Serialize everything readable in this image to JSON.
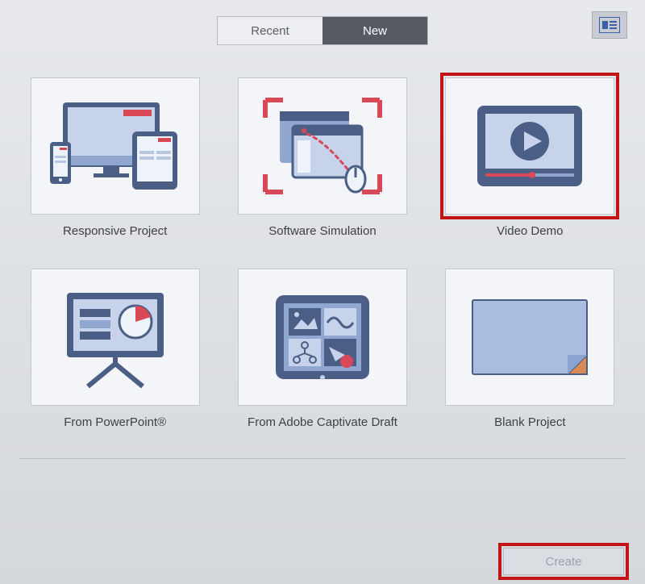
{
  "colors": {
    "accent_red": "#c11515",
    "slate_dark": "#4b5f86",
    "slate_mid": "#90a7cf",
    "slate_light": "#c6d3ea",
    "panel": "#f3f5f8"
  },
  "tabs": {
    "recent": "Recent",
    "new": "New",
    "active": "new"
  },
  "view_toggle": {
    "name": "list-view-icon"
  },
  "cards": [
    {
      "id": "responsive-project",
      "label": "Responsive Project",
      "selected": false
    },
    {
      "id": "software-simulation",
      "label": "Software Simulation",
      "selected": false
    },
    {
      "id": "video-demo",
      "label": "Video Demo",
      "selected": true
    },
    {
      "id": "from-powerpoint",
      "label": "From PowerPoint®",
      "selected": false
    },
    {
      "id": "from-captivate-draft",
      "label": "From Adobe Captivate Draft",
      "selected": false
    },
    {
      "id": "blank-project",
      "label": "Blank Project",
      "selected": false
    }
  ],
  "footer": {
    "create": "Create"
  }
}
